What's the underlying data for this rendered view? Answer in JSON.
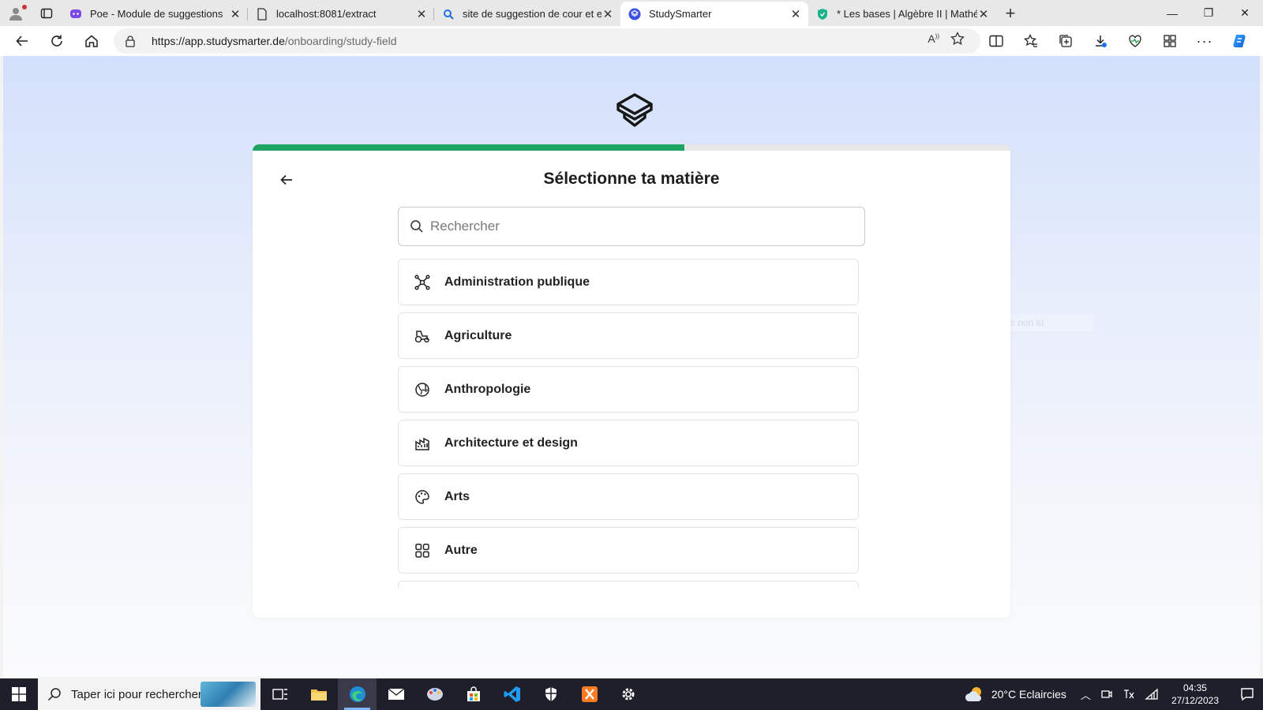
{
  "browser": {
    "tabs": [
      {
        "title": "Poe - Module de suggestions",
        "favicon": "poe-icon",
        "active": false
      },
      {
        "title": "localhost:8081/extract",
        "favicon": "page-icon",
        "active": false
      },
      {
        "title": "site de suggestion de cour et exe",
        "favicon": "search-icon",
        "active": false
      },
      {
        "title": "StudySmarter",
        "favicon": "studysmarter-icon",
        "active": true
      },
      {
        "title": "* Les bases | Algèbre II | Mathém",
        "favicon": "shield-icon",
        "active": false
      }
    ],
    "url_host": "https://app.studysmarter.de",
    "url_path": "/onboarding/study-field",
    "window_controls": {
      "minimize": "—",
      "restore": "❐",
      "close": "✕"
    }
  },
  "page": {
    "title": "Sélectionne ta matière",
    "progress": 0.57,
    "search_placeholder": "Rechercher",
    "subjects": [
      {
        "label": "Administration publique",
        "icon": "network-icon"
      },
      {
        "label": "Agriculture",
        "icon": "tractor-icon"
      },
      {
        "label": "Anthropologie",
        "icon": "globe-icon"
      },
      {
        "label": "Architecture et design",
        "icon": "building-icon"
      },
      {
        "label": "Arts",
        "icon": "palette-icon"
      },
      {
        "label": "Autre",
        "icon": "grid-icon"
      },
      {
        "label": "",
        "icon": ""
      }
    ],
    "ghost_text": "Cours non lu"
  },
  "taskbar": {
    "search_placeholder": "Taper ici pour rechercher",
    "apps": [
      "task-view-icon",
      "file-explorer-icon",
      "edge-icon",
      "mail-icon",
      "paint-icon",
      "store-icon",
      "vscode-icon",
      "security-icon",
      "xampp-icon",
      "settings-icon"
    ],
    "weather": "20°C  Eclaircies",
    "time": "04:35",
    "date": "27/12/2023"
  },
  "colors": {
    "accent_green": "#1fa463",
    "studysmarter_blue": "#3b4fe0",
    "taskbar_bg": "#1f1f2b"
  }
}
